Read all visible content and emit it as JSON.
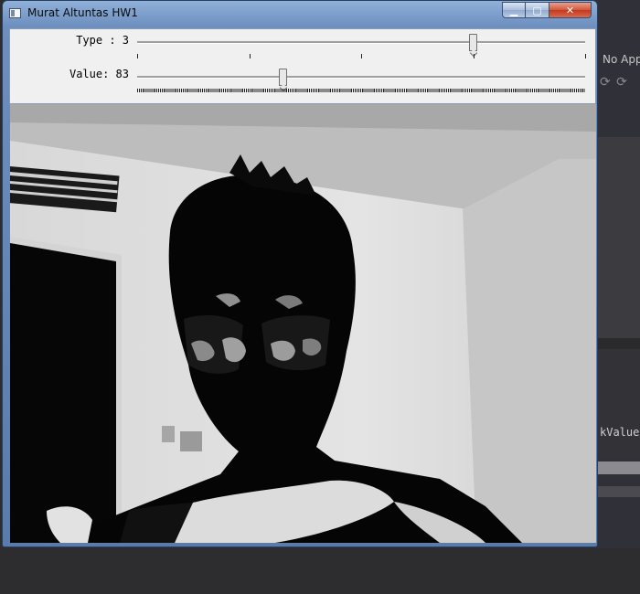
{
  "window": {
    "title": "Murat Altuntas HW1",
    "controls": {
      "minimize": "▁",
      "maximize": "▢",
      "close": "✕"
    }
  },
  "trackbars": [
    {
      "label_text": "Type : 3",
      "value": 3,
      "max": 4
    },
    {
      "label_text": "Value: 83",
      "value": 83,
      "max": 255
    }
  ],
  "background_ide": {
    "top_text": "No App",
    "side_text": "kValue"
  },
  "colors": {
    "title_gradient_top": "#8fb0d8",
    "panel_bg": "#f0f0f0",
    "close_button": "#c23a20"
  }
}
